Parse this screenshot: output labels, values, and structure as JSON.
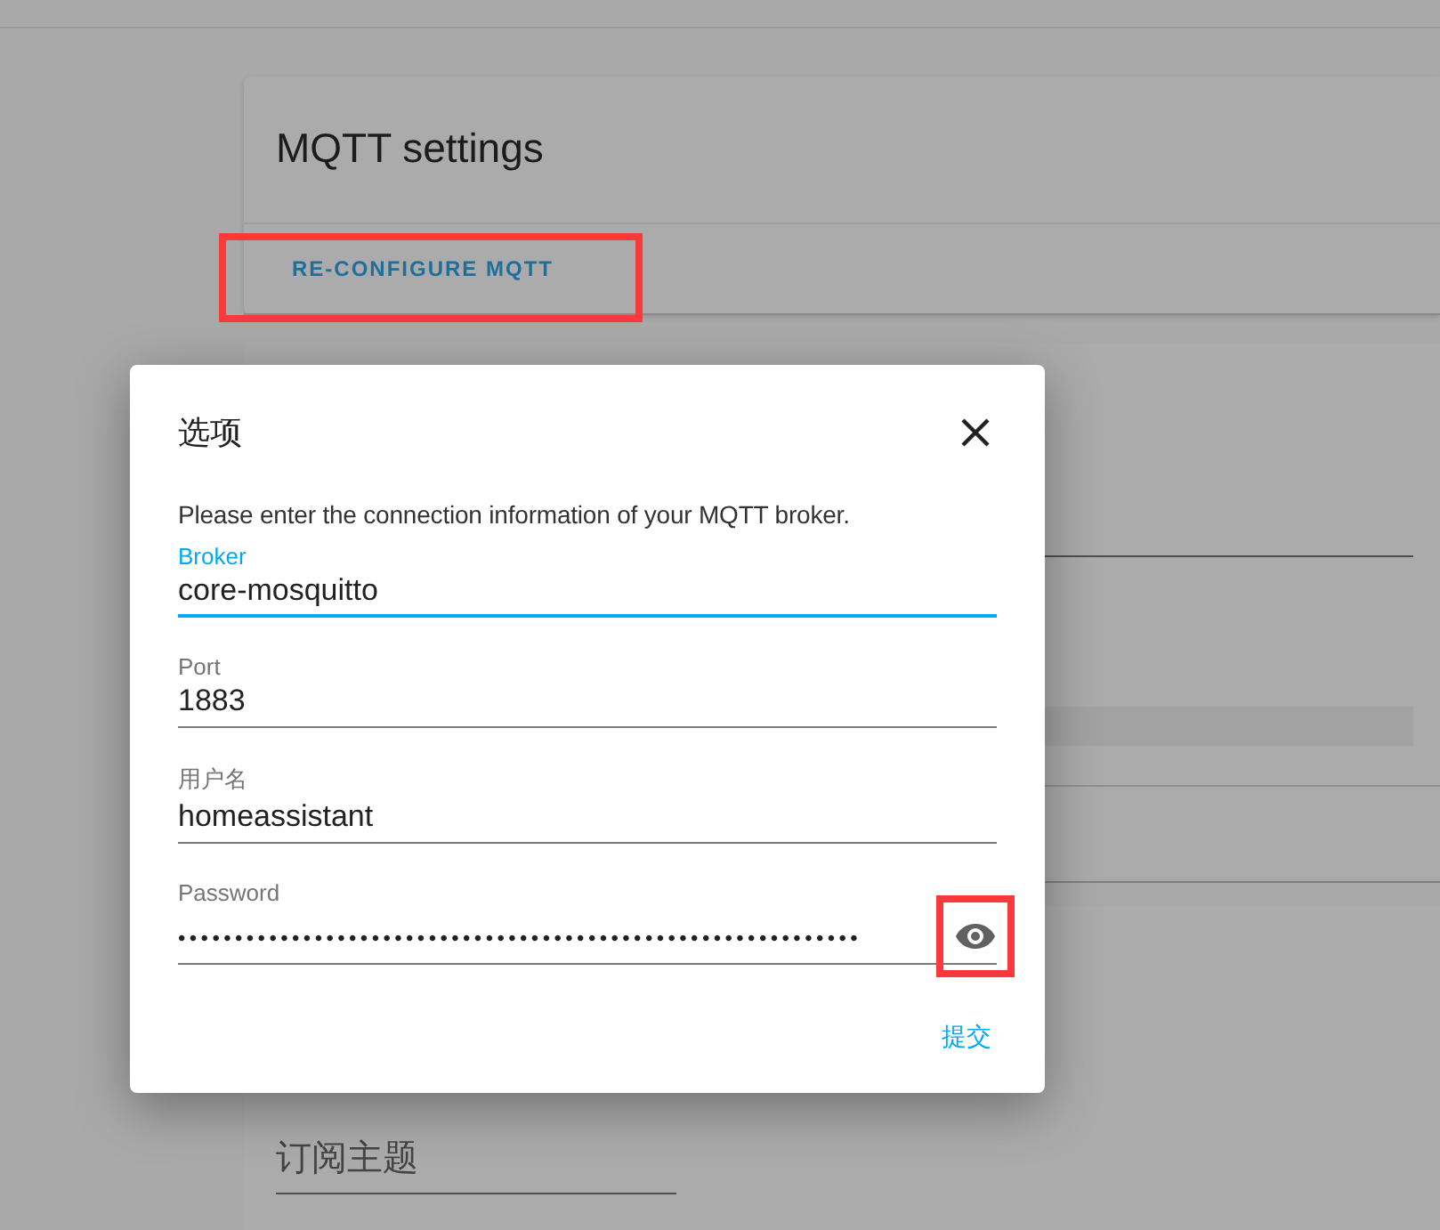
{
  "settings_card": {
    "title": "MQTT settings",
    "reconfigure_button": {
      "label": "RE-CONFIGURE MQTT",
      "highlighted": true
    }
  },
  "subscribe_card": {
    "topic_field": {
      "placeholder": "订阅主题"
    }
  },
  "dialog": {
    "title": "选项",
    "description": "Please enter the connection information of your MQTT broker.",
    "fields": [
      {
        "label": "Broker",
        "value": "core-mosquitto",
        "focused": true,
        "kind": "text"
      },
      {
        "label": "Port",
        "value": "1883",
        "focused": false,
        "kind": "text"
      },
      {
        "label": "用户名",
        "value": "homeassistant",
        "focused": false,
        "kind": "text"
      },
      {
        "label": "Password",
        "value": "••••••••••••••••••••••••••••••••••••••••••••••••••••••••••••",
        "focused": false,
        "kind": "password",
        "reveal_highlighted": true
      }
    ],
    "submit_button": "提交"
  }
}
